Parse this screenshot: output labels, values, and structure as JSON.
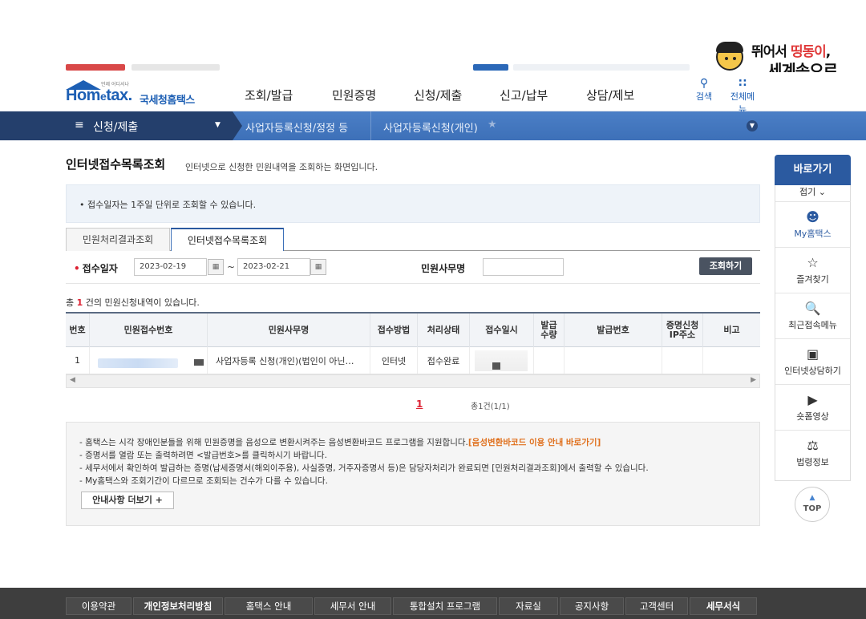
{
  "watermark": {
    "line1_a": "뛰어서 ",
    "line1_b": "띵동이",
    "line1_c": ",",
    "line2": "세계속으로"
  },
  "header": {
    "logo_sub": "언제 어디서나",
    "logo_main": "Hom",
    "logo_e": "e",
    "logo_tax": "tax",
    "logo_dot": ".",
    "logo_kr": "국세청홈택스",
    "menus": [
      "조회/발급",
      "민원증명",
      "신청/제출",
      "신고/납부",
      "상담/제보"
    ],
    "search_label": "검색",
    "all_menu_label": "전체메뉴"
  },
  "breadcrumb": {
    "menu_label": "신청/제출",
    "item1": "사업자등록신청/정정 등",
    "item2": "사업자등록신청(개인)"
  },
  "page": {
    "title": "인터넷접수목록조회",
    "description": "인터넷으로 신청한 민원내역을 조회하는 화면입니다.",
    "top_notice": "• 접수일자는 1주일 단위로 조회할 수 있습니다."
  },
  "tabs": [
    {
      "label": "민원처리결과조회",
      "active": false
    },
    {
      "label": "인터넷접수목록조회",
      "active": true
    }
  ],
  "search": {
    "date_label": "접수일자",
    "date_from": "2023-02-19",
    "date_to": "2023-02-21",
    "tilde": "~",
    "affair_label": "민원사무명",
    "affair_value": "",
    "button": "조회하기"
  },
  "result": {
    "prefix": "총 ",
    "count": "1",
    "suffix": " 건의 민원신청내역이 있습니다."
  },
  "table": {
    "headers": [
      "번호",
      "민원접수번호",
      "민원사무명",
      "접수방법",
      "처리상태",
      "접수일시",
      "발급\n수량",
      "발급번호",
      "증명신청\nIP주소",
      "비고"
    ],
    "rows": [
      {
        "no": "1",
        "receipt_no": "",
        "affair": "사업자등록 신청(개인)(법인이 아닌…",
        "method": "인터넷",
        "status": "접수완료",
        "datetime": "",
        "qty": "",
        "issue_no": "",
        "ip": "",
        "note": ""
      }
    ]
  },
  "pager": {
    "current": "1",
    "total": "총1건(1/1)"
  },
  "notice": {
    "line1_a": "- 홈택스는 시각 장애인분들을 위해 민원증명을 음성으로 변환시켜주는 음성변환바코드 프로그램을 지원합니다.",
    "line1_b": "[음성변환바코드 이용 안내 바로가기]",
    "line2": "- 증명서를 열람 또는 출력하려면 <발급번호>를 클릭하시기 바랍니다.",
    "line3": "- 세무서에서 확인하여 발급하는 증명(납세증명서(해외이주용), 사실증명, 거주자증명서 등)은 담당자처리가 완료되면 [민원처리결과조회]에서 출력할 수 있습니다.",
    "line4": "- My홈택스와 조회기간이 다르므로 조회되는 건수가 다를 수 있습니다.",
    "more_button": "안내사항 더보기 +"
  },
  "quick_menu": {
    "title": "바로가기",
    "fold": "접기 ⌄",
    "items": [
      "My홈택스",
      "즐겨찾기",
      "최근접속메뉴",
      "인터넷상담하기",
      "숏폼영상",
      "법령정보"
    ],
    "top": "TOP"
  },
  "footer": {
    "links": [
      "이용약관",
      "개인정보처리방침",
      "홈택스 안내",
      "세무서 안내",
      "통합설치 프로그램",
      "자료실",
      "공지사항",
      "고객센터",
      "세무서식"
    ]
  },
  "colors": {
    "brand_blue": "#1d5fb4",
    "nav_dark": "#243f6c",
    "accent_red": "#dd2233",
    "notice_orange": "#e0701d"
  }
}
